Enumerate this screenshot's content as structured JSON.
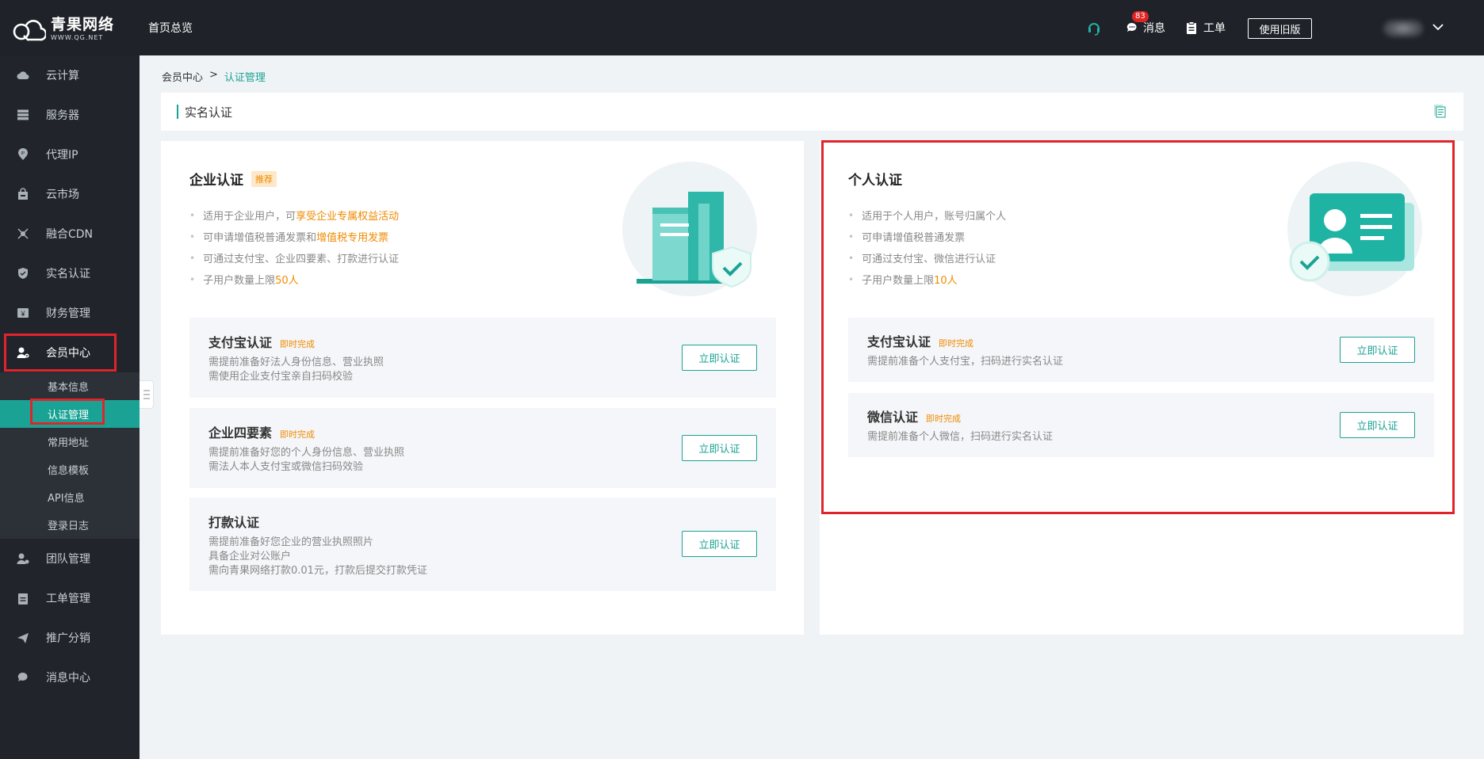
{
  "topbar": {
    "logo_cn": "青果网络",
    "logo_en": "WWW.QG.NET",
    "home_label": "首页总览",
    "message_label": "消息",
    "message_count": "83",
    "ticket_label": "工单",
    "old_version_label": "使用旧版"
  },
  "sidebar": {
    "items": [
      {
        "label": "云计算",
        "icon": "cloud-icon"
      },
      {
        "label": "服务器",
        "icon": "server-icon"
      },
      {
        "label": "代理IP",
        "icon": "location-pin-icon"
      },
      {
        "label": "云市场",
        "icon": "shopping-bag-icon"
      },
      {
        "label": "融合CDN",
        "icon": "network-icon"
      },
      {
        "label": "实名认证",
        "icon": "shield-check-icon"
      },
      {
        "label": "财务管理",
        "icon": "finance-icon"
      },
      {
        "label": "会员中心",
        "icon": "user-gear-icon"
      },
      {
        "label": "团队管理",
        "icon": "team-icon"
      },
      {
        "label": "工单管理",
        "icon": "clipboard-icon"
      },
      {
        "label": "推广分销",
        "icon": "paper-plane-icon"
      },
      {
        "label": "消息中心",
        "icon": "chat-bubble-icon"
      }
    ],
    "sub_items": [
      "基本信息",
      "认证管理",
      "常用地址",
      "信息模板",
      "API信息",
      "登录日志"
    ]
  },
  "breadcrumb": {
    "parent": "会员中心",
    "separator": ">",
    "current": "认证管理"
  },
  "page": {
    "title": "实名认证"
  },
  "enterprise": {
    "title": "企业认证",
    "tag": "推荐",
    "bullets": [
      {
        "text": "适用于企业用户，可",
        "highlight": "享受企业专属权益活动",
        "suffix": ""
      },
      {
        "text": "可申请增值税普通发票和",
        "highlight": "增值税专用发票",
        "suffix": ""
      },
      {
        "text": "可通过支付宝、企业四要素、打款进行认证",
        "highlight": "",
        "suffix": ""
      },
      {
        "text": "子用户数量上限",
        "highlight": "50人",
        "suffix": ""
      }
    ],
    "methods": [
      {
        "title": "支付宝认证",
        "quick": "即时完成",
        "desc": [
          "需提前准备好法人身份信息、营业执照",
          "需使用企业支付宝亲自扫码校验"
        ],
        "button": "立即认证"
      },
      {
        "title": "企业四要素",
        "quick": "即时完成",
        "desc": [
          "需提前准备好您的个人身份信息、营业执照",
          "需法人本人支付宝或微信扫码效验"
        ],
        "button": "立即认证"
      },
      {
        "title": "打款认证",
        "quick": "",
        "desc": [
          "需提前准备好您企业的营业执照照片",
          "具备企业对公账户",
          "需向青果网络打款0.01元，打款后提交打款凭证"
        ],
        "button": "立即认证"
      }
    ]
  },
  "personal": {
    "title": "个人认证",
    "bullets": [
      {
        "text": "适用于个人用户，账号归属个人",
        "highlight": "",
        "suffix": ""
      },
      {
        "text": "可申请增值税普通发票",
        "highlight": "",
        "suffix": ""
      },
      {
        "text": "可通过支付宝、微信进行认证",
        "highlight": "",
        "suffix": ""
      },
      {
        "text": "子用户数量上限",
        "highlight": "10人",
        "suffix": ""
      }
    ],
    "methods": [
      {
        "title": "支付宝认证",
        "quick": "即时完成",
        "desc": [
          "需提前准备个人支付宝，扫码进行实名认证"
        ],
        "button": "立即认证"
      },
      {
        "title": "微信认证",
        "quick": "即时完成",
        "desc": [
          "需提前准备个人微信，扫码进行实名认证"
        ],
        "button": "立即认证"
      }
    ]
  },
  "colors": {
    "accent": "#1aa394",
    "highlight": "#f08a00",
    "topbar": "#1f2329",
    "sidebar": "#21252b",
    "annotation": "#e0242c"
  }
}
